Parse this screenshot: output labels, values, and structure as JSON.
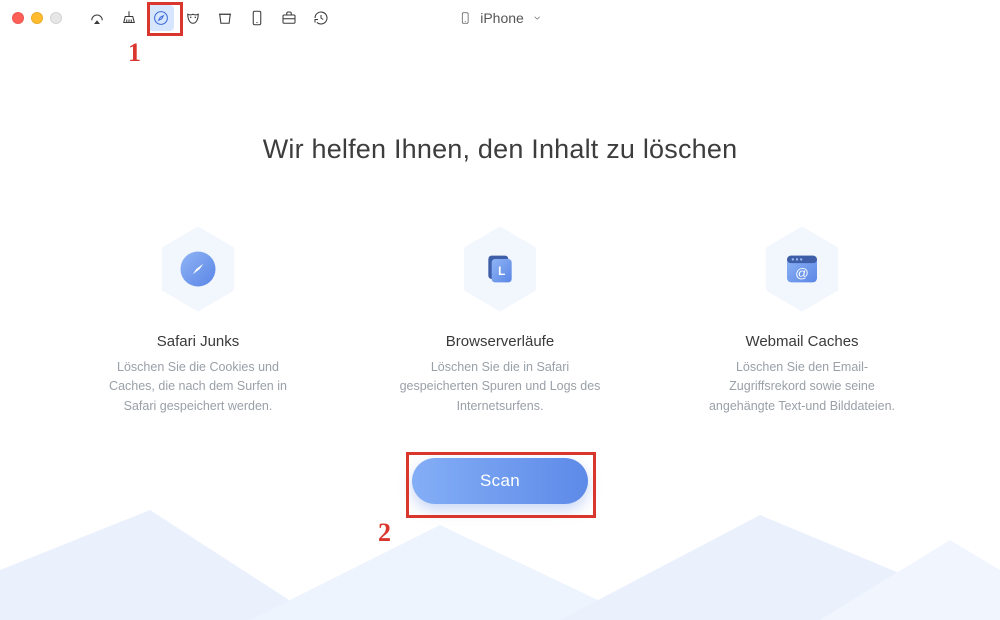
{
  "device_selector": {
    "label": "iPhone"
  },
  "headline": "Wir helfen Ihnen, den Inhalt zu löschen",
  "cards": {
    "safari": {
      "title": "Safari Junks",
      "desc": "Löschen Sie die Cookies und Caches, die nach dem Surfen in Safari gespeichert werden."
    },
    "history": {
      "title": "Browserverläufe",
      "desc": "Löschen Sie die in Safari gespeicherten Spuren und Logs des Internetsurfens."
    },
    "webmail": {
      "title": "Webmail Caches",
      "desc": "Löschen Sie den Email-Zugriffsrekord sowie seine angehängte Text-und Bilddateien."
    }
  },
  "scan_label": "Scan",
  "annotations": {
    "step1": "1",
    "step2": "2"
  },
  "colors": {
    "accent": "#5d8ae8",
    "highlight": "#d9362e"
  }
}
